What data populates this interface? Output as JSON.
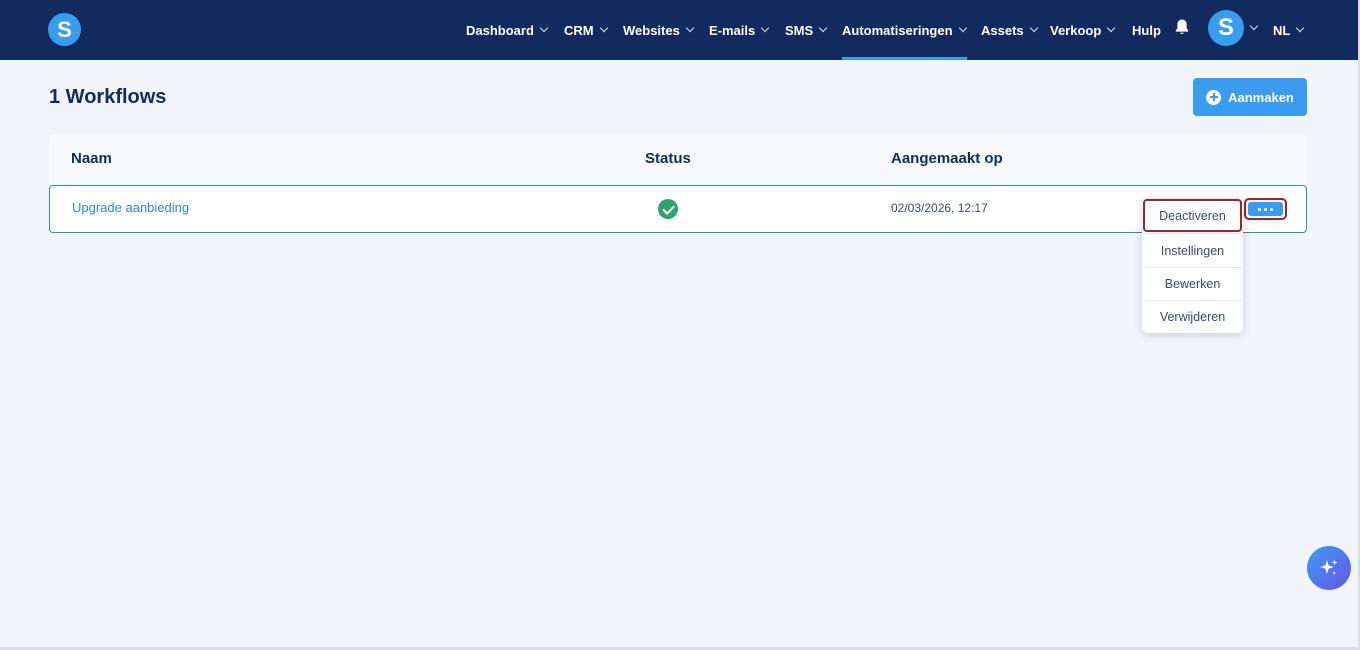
{
  "app": {
    "logo_letter": "S",
    "avatar_letter": "S",
    "language": "NL"
  },
  "nav": {
    "items": [
      {
        "label": "Dashboard"
      },
      {
        "label": "CRM"
      },
      {
        "label": "Websites"
      },
      {
        "label": "E-mails"
      },
      {
        "label": "SMS"
      },
      {
        "label": "Automatiseringen"
      },
      {
        "label": "Assets"
      },
      {
        "label": "Verkoop"
      },
      {
        "label": "Hulp"
      }
    ],
    "active": "Automatiseringen",
    "icons": {
      "notifications": "bell-icon",
      "chevron": "chevron-down-icon"
    }
  },
  "page": {
    "title": "1 Workflows",
    "create_button_label": "Aanmaken",
    "create_button_icon": "plus-circle-icon"
  },
  "table": {
    "columns": [
      "Naam",
      "Status",
      "Aangemaakt op"
    ],
    "rows": [
      {
        "name": "Upgrade aanbieding",
        "status": "active",
        "status_icon": "check-circle-icon",
        "created_at": "02/03/2026, 12:17"
      }
    ]
  },
  "row_menu": {
    "items": [
      "Deactiveren",
      "Instellingen",
      "Bewerken",
      "Verwijderen"
    ],
    "highlighted": "Deactiveren",
    "trigger_icon": "more-horizontal-icon"
  },
  "assistant": {
    "icon": "sparkles-icon"
  },
  "colors": {
    "nav_bg": "#132a5e",
    "accent": "#3a9cf0",
    "status_ok": "#2fa36b",
    "highlight": "#a3212a"
  }
}
